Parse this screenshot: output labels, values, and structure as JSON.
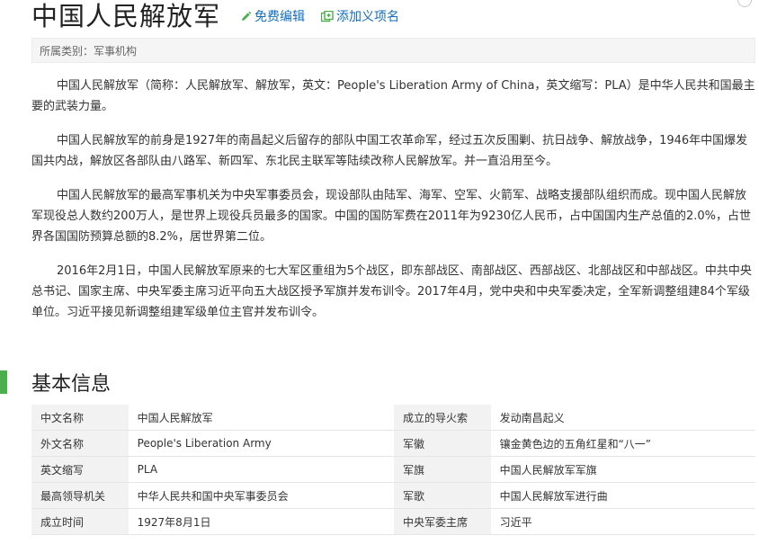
{
  "header": {
    "title": "中国人民解放军",
    "edit_label": "免费编辑",
    "add_meaning_label": "添加义项名"
  },
  "category": {
    "prefix": "所属类别：",
    "value": "军事机构"
  },
  "paragraphs": [
    "中国人民解放军（简称：人民解放军、解放军，英文：People's Liberation Army of China，英文缩写：PLA）是中华人民共和国最主要的武装力量。",
    "中国人民解放军的前身是1927年的南昌起义后留存的部队中国工农革命军，经过五次反围剿、抗日战争、解放战争，1946年中国爆发国共内战，解放区各部队由八路军、新四军、东北民主联军等陆续改称人民解放军。并一直沿用至今。",
    "中国人民解放军的最高军事机关为中央军事委员会，现设部队由陆军、海军、空军、火箭军、战略支援部队组织而成。现中国人民解放军现役总人数约200万人，是世界上现役兵员最多的国家。中国的国防军费在2011年为9230亿人民币，占中国国内生产总值的2.0%，占世界各国国防预算总额的8.2%，居世界第二位。",
    "2016年2月1日，中国人民解放军原来的七大军区重组为5个战区，即东部战区、南部战区、西部战区、北部战区和中部战区。中共中央总书记、国家主席、中央军委主席习近平向五大战区授予军旗并发布训令。2017年4月，党中央和中央军委决定，全军新调整组建84个军级单位。习近平接见新调整组建军级单位主官并发布训令。"
  ],
  "basic_info": {
    "section_title": "基本信息",
    "rows": [
      {
        "label_left": "中文名称",
        "value_left": "中国人民解放军",
        "label_right": "成立的导火索",
        "value_right": "发动南昌起义"
      },
      {
        "label_left": "外文名称",
        "value_left": "People's Liberation Army",
        "label_right": "军徽",
        "value_right": "镶金黄色边的五角红星和“八一”"
      },
      {
        "label_left": "英文缩写",
        "value_left": "PLA",
        "label_right": "军旗",
        "value_right": "中国人民解放军军旗"
      },
      {
        "label_left": "最高领导机关",
        "value_left": "中华人民共和国中央军事委员会",
        "label_right": "军歌",
        "value_right": "中国人民解放军进行曲"
      },
      {
        "label_left": "成立时间",
        "value_left": "1927年8月1日",
        "label_right": "中央军委主席",
        "value_right": "习近平"
      }
    ]
  },
  "colors": {
    "link": "#136ec2",
    "section_accent": "#4cae4c",
    "edit_icon": "#4cae4c"
  },
  "icons": {
    "edit": "pencil-icon",
    "add": "add-meaning-icon"
  }
}
